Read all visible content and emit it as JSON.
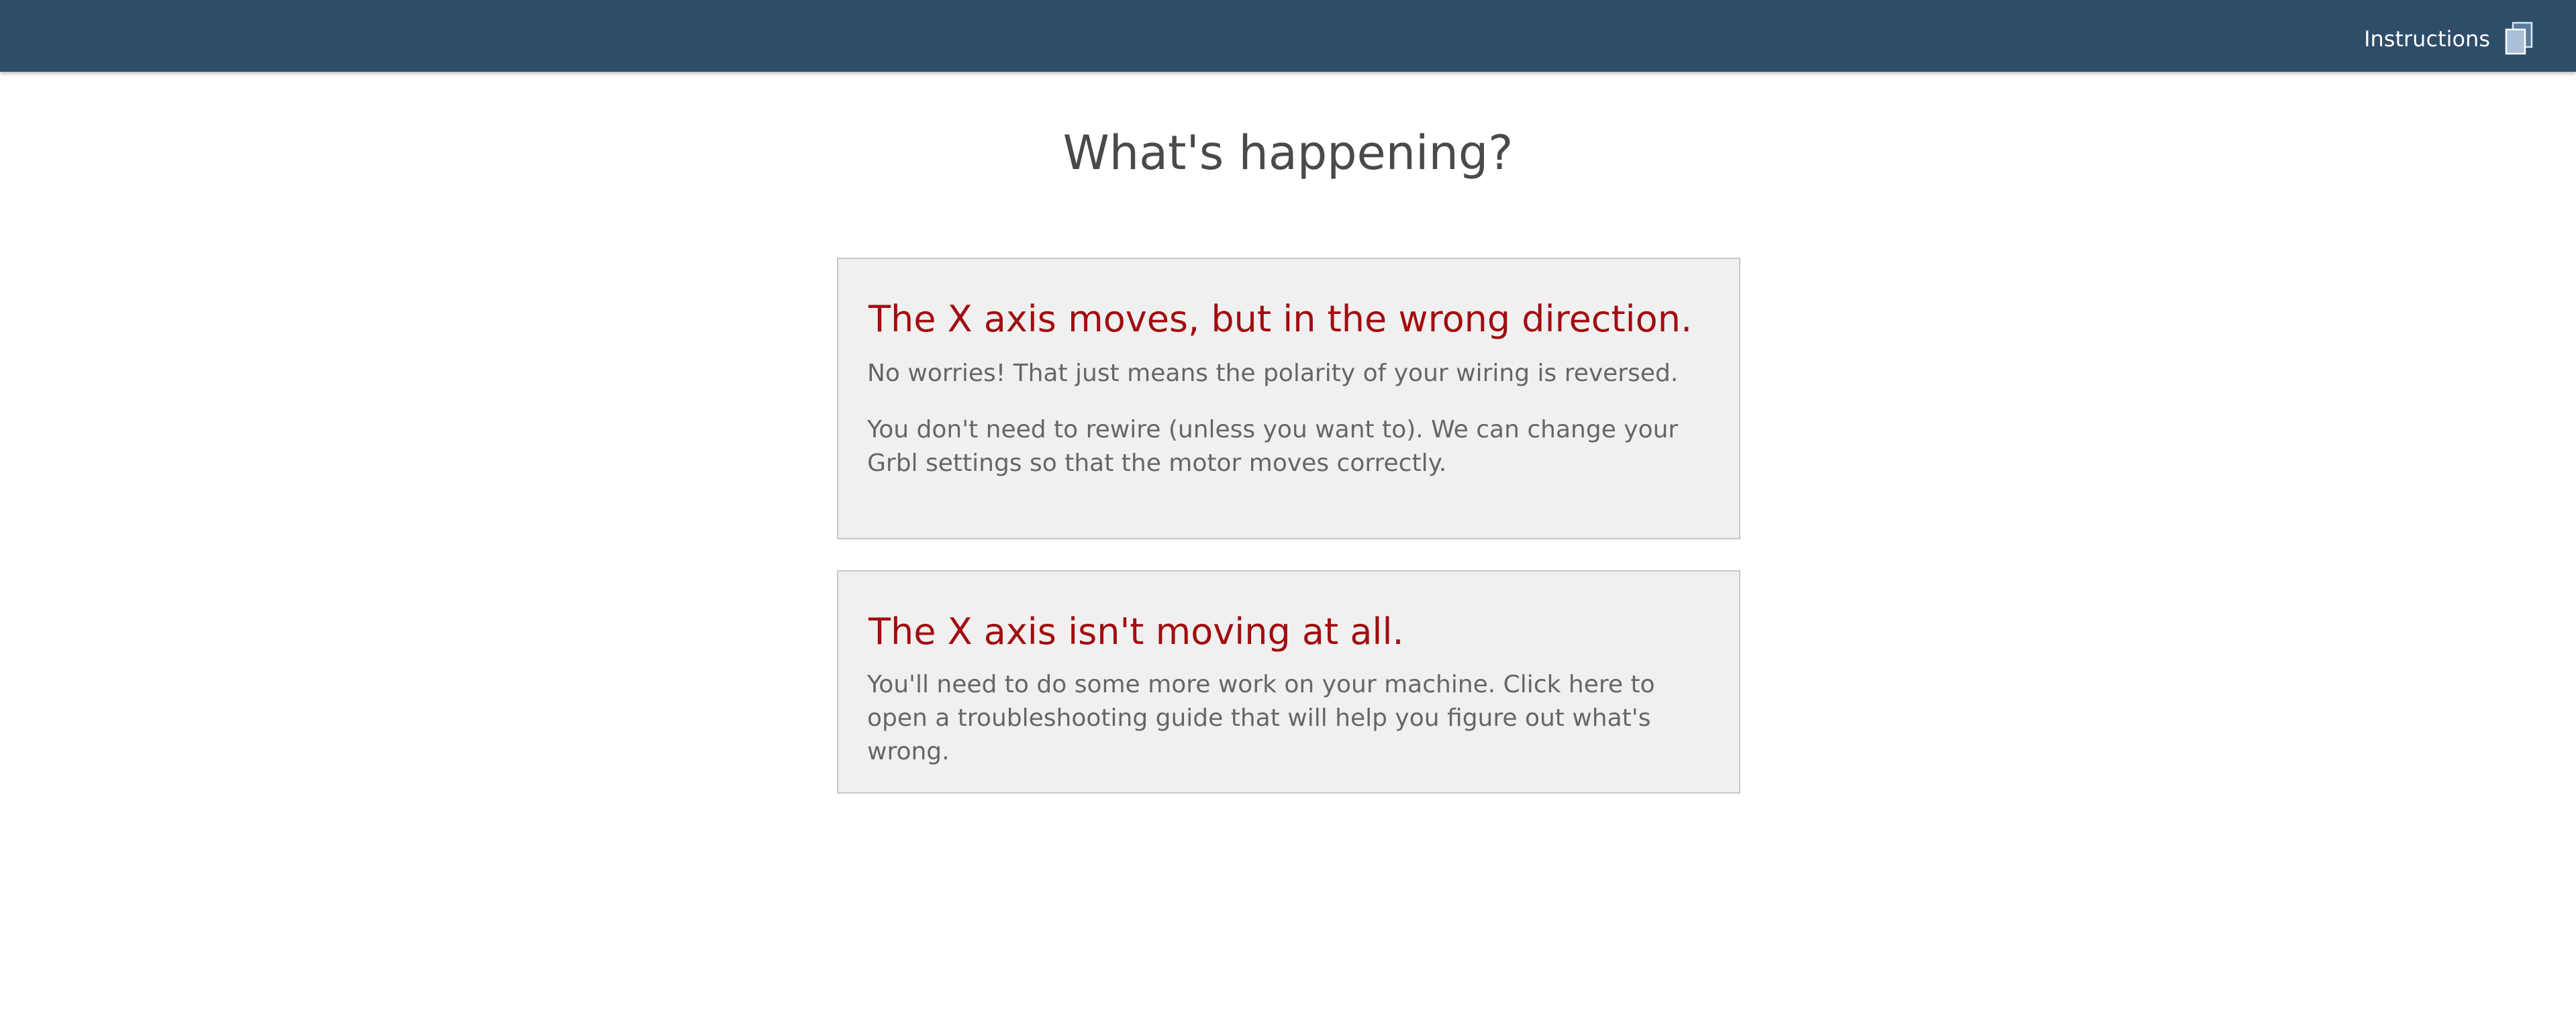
{
  "header": {
    "instructions_label": "Instructions",
    "icon": "copy-pages-icon"
  },
  "main": {
    "title": "What's happening?",
    "options": [
      {
        "title": "The X axis moves, but in the wrong direction.",
        "paragraphs": [
          "No worries! That just means the polarity of your wiring is reversed.",
          "You don't need to rewire (unless you want to). We can change your Grbl settings so that the motor moves correctly."
        ]
      },
      {
        "title": "The X axis isn't moving at all.",
        "paragraphs": [
          "You'll need to do some more work on your machine. Click here to open a troubleshooting guide that will help you figure out what's wrong."
        ]
      }
    ]
  },
  "colors": {
    "topbar": "#2e4d69",
    "heading_red": "#a10d10",
    "card_bg": "#f0f0f0",
    "body_text": "#666666"
  }
}
